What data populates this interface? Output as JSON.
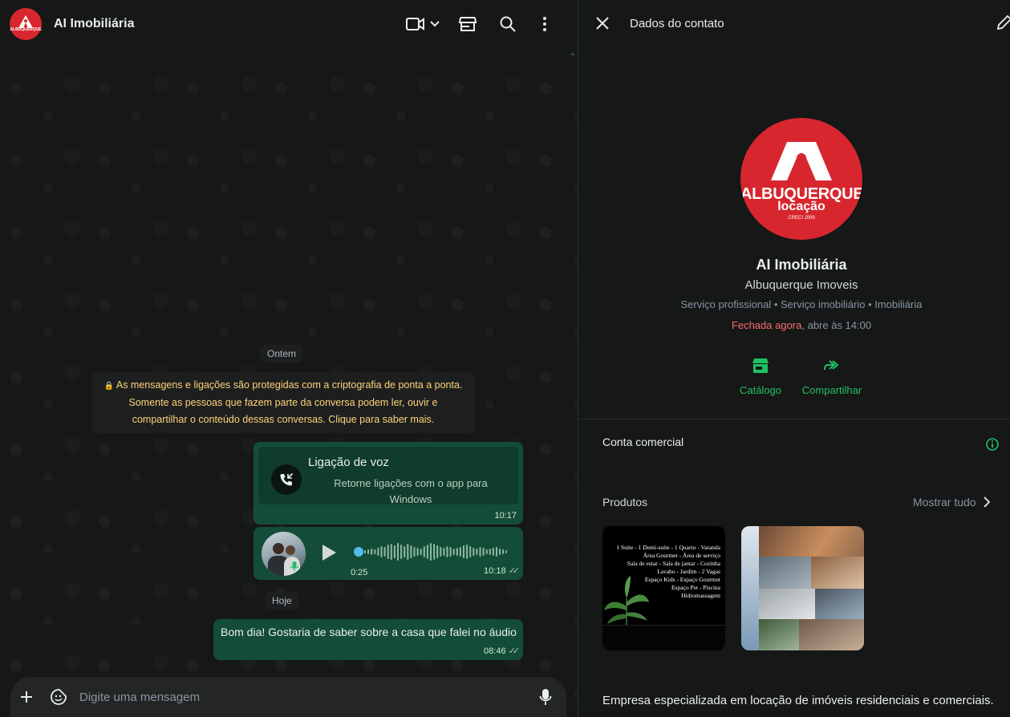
{
  "chat": {
    "title": "AI Imobiliária",
    "avatar_text": "ALBUQUERQUE",
    "date_yesterday": "Ontem",
    "date_today": "Hoje",
    "encryption_notice": "As mensagens e ligações são protegidas com a criptografia de ponta a ponta. Somente as pessoas que fazem parte da conversa podem ler, ouvir e compartilhar o conteúdo dessas conversas. Clique para saber mais.",
    "call_message": {
      "title": "Ligação de voz",
      "subtitle": "Retorne ligações com o app para Windows",
      "time": "10:17"
    },
    "audio_message": {
      "duration": "0:25",
      "time": "10:18",
      "progress": 0
    },
    "text_message": {
      "text": "Bom dia! Gostaria de saber sobre a casa que falei no áudio",
      "time": "08:46"
    },
    "composer": {
      "placeholder": "Digite uma mensagem"
    },
    "header_icons": [
      "video-call-icon",
      "chevron-down-icon",
      "catalog-store-icon",
      "search-icon",
      "menu-dots-icon"
    ]
  },
  "contact": {
    "header_title": "Dados do contato",
    "name": "AI Imobiliária",
    "subtitle": "Albuquerque Imoveis",
    "categories": "Serviço profissional • Serviço imobiliário • Imobiliária",
    "status_closed": "Fechada agora",
    "status_opens": ", abre às 14:00",
    "logo_line1": "ALBUQUERQUE",
    "logo_line2": "locação",
    "logo_line3": "CRECI J009",
    "actions": {
      "catalog": "Catálogo",
      "share": "Compartilhar"
    },
    "business_account_label": "Conta comercial",
    "products_label": "Produtos",
    "show_all": "Mostrar tudo",
    "product1_lines": [
      "1 Suíte - 1 Demi-suíte - 1 Quarto - Varanda",
      "Área Gourmet - Área de serviço",
      "Sala de estar - Sala de jantar - Cozinha",
      "Lavabo - Jardim - 2 Vagas",
      "Espaço Kids - Espaço Gourmet",
      "Espaço Pet - Piscina",
      "Hidromassagem"
    ],
    "description": "Empresa especializada em locação de imóveis residenciais e comerciais."
  },
  "colors": {
    "accent_green": "#21c063",
    "bubble_green": "#144d37",
    "closed_red": "#ff6b6b",
    "brand_red": "#d8262e"
  }
}
